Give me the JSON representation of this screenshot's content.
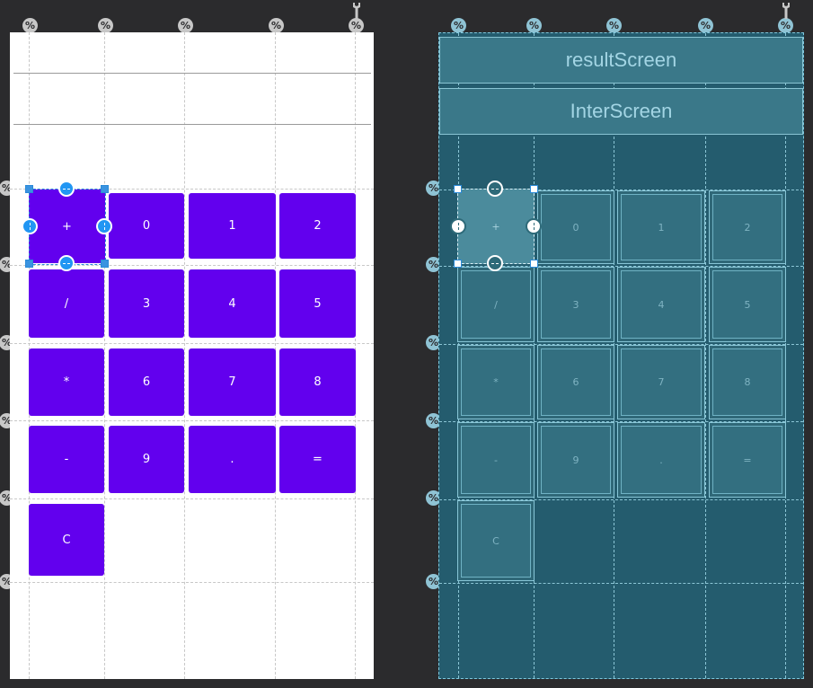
{
  "design": {
    "buttons": [
      {
        "label": "+"
      },
      {
        "label": "0"
      },
      {
        "label": "1"
      },
      {
        "label": "2"
      },
      {
        "label": "/"
      },
      {
        "label": "3"
      },
      {
        "label": "4"
      },
      {
        "label": "5"
      },
      {
        "label": "*"
      },
      {
        "label": "6"
      },
      {
        "label": "7"
      },
      {
        "label": "8"
      },
      {
        "label": "-"
      },
      {
        "label": "9"
      },
      {
        "label": "."
      },
      {
        "label": "="
      },
      {
        "label": "C"
      }
    ],
    "button_color": "#6200ee",
    "selected_button": "+"
  },
  "blueprint": {
    "result_screen_label": "resultScreen",
    "inter_screen_label": "InterScreen",
    "background_color": "#245c6e"
  },
  "guideline_marker": "%",
  "icons": {
    "guideline": "percent-guideline-icon",
    "tools": "wrench-icon",
    "handle": "constraint-handle-icon"
  }
}
